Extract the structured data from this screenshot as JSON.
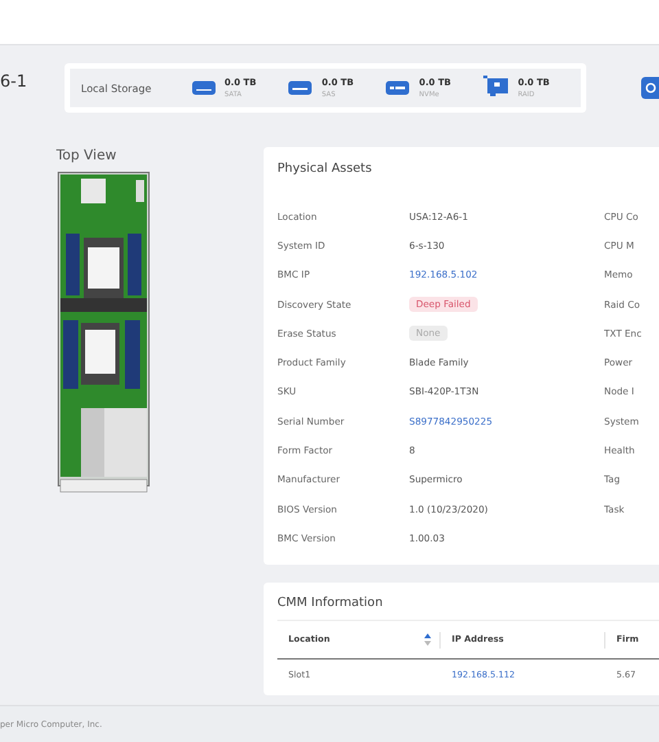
{
  "header": {
    "title": "6-1"
  },
  "local_storage": {
    "label": "Local Storage",
    "items": [
      {
        "kind": "sata",
        "value": "0.0 TB",
        "label": "SATA"
      },
      {
        "kind": "sas",
        "value": "0.0 TB",
        "label": "SAS"
      },
      {
        "kind": "nvme",
        "value": "0.0 TB",
        "label": "NVMe"
      },
      {
        "kind": "raid",
        "value": "0.0 TB",
        "label": "RAID"
      }
    ]
  },
  "top_view": {
    "title": "Top View"
  },
  "physical_assets": {
    "title": "Physical Assets",
    "rows": [
      {
        "label": "Location",
        "value": "USA:12-A6-1",
        "kind": "text",
        "column_3": "CPU Co"
      },
      {
        "label": "System ID",
        "value": "6-s-130",
        "kind": "text",
        "column_3": "CPU M"
      },
      {
        "label": "BMC IP",
        "value": "192.168.5.102",
        "kind": "link",
        "column_3": "Memo"
      },
      {
        "label": "Discovery State",
        "value": "Deep Failed",
        "kind": "error-badge",
        "column_3": "Raid Co"
      },
      {
        "label": "Erase Status",
        "value": "None",
        "kind": "neutral-badge",
        "column_3": "TXT Enc"
      },
      {
        "label": "Product Family",
        "value": "Blade Family",
        "kind": "text",
        "column_3": "Power"
      },
      {
        "label": "SKU",
        "value": "SBI-420P-1T3N",
        "kind": "text",
        "column_3": "Node I"
      },
      {
        "label": "Serial Number",
        "value": "S8977842950225",
        "kind": "link",
        "column_3": "System"
      },
      {
        "label": "Form Factor",
        "value": "8",
        "kind": "text",
        "column_3": "Health"
      },
      {
        "label": "Manufacturer",
        "value": "Supermicro",
        "kind": "text",
        "column_3": "Tag"
      },
      {
        "label": "BIOS Version",
        "value": "1.0 (10/23/2020)",
        "kind": "text",
        "column_3": "Task"
      },
      {
        "label": "BMC Version",
        "value": "1.00.03",
        "kind": "text"
      }
    ]
  },
  "cmm_information": {
    "title": "CMM Information",
    "columns": [
      {
        "label": "Location",
        "sortable": true
      },
      {
        "label": "IP Address",
        "sortable": false
      },
      {
        "label": "Firm",
        "sortable": false
      }
    ],
    "rows": [
      [
        {
          "text": "Slot1",
          "kind": "text"
        },
        {
          "text": "192.168.5.112",
          "kind": "link"
        },
        {
          "text": "5.67",
          "kind": "text"
        }
      ]
    ]
  },
  "footer": {
    "text": "per Micro Computer, Inc."
  }
}
